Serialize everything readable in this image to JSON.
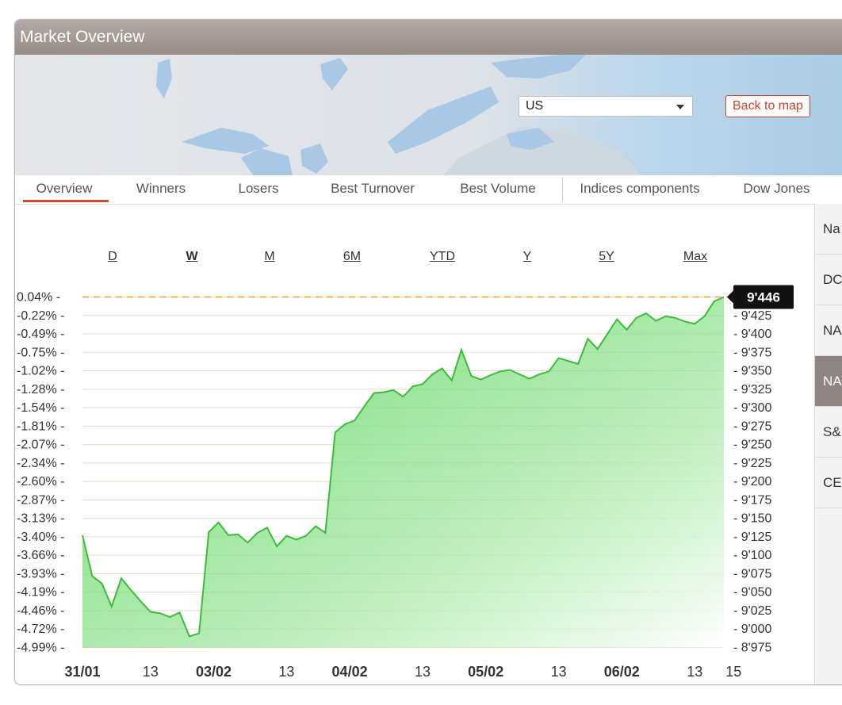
{
  "window": {
    "title": "Market Overview"
  },
  "map": {
    "region_select": {
      "value": "US"
    },
    "back_button": {
      "label": "Back to map"
    }
  },
  "tabs": [
    {
      "label": "Overview",
      "active": true
    },
    {
      "label": "Winners"
    },
    {
      "label": "Losers"
    },
    {
      "label": "Best Turnover"
    },
    {
      "label": "Best Volume"
    },
    {
      "label": "Indices components"
    },
    {
      "label": "Dow Jones"
    }
  ],
  "side_list": [
    {
      "label": "Na"
    },
    {
      "label": "DC"
    },
    {
      "label": "NA"
    },
    {
      "label": "NA",
      "active": true
    },
    {
      "label": "S&"
    },
    {
      "label": "CE"
    }
  ],
  "periods": [
    {
      "label": "D"
    },
    {
      "label": "W",
      "active": true
    },
    {
      "label": "M"
    },
    {
      "label": "6M"
    },
    {
      "label": "YTD"
    },
    {
      "label": "Y"
    },
    {
      "label": "5Y"
    },
    {
      "label": "Max"
    }
  ],
  "colors": {
    "accent": "#d24a2a",
    "line": "#3bbd3b",
    "fill": "#55cc55",
    "ref_line": "#f5a030"
  },
  "chart_data": {
    "type": "area",
    "ylim": [
      8975,
      9446
    ],
    "current_value_label": "9'446",
    "y_right_ticks": [
      "9'425",
      "9'400",
      "9'375",
      "9'350",
      "9'325",
      "9'300",
      "9'275",
      "9'250",
      "9'225",
      "9'200",
      "9'175",
      "9'150",
      "9'125",
      "9'100",
      "9'075",
      "9'050",
      "9'025",
      "9'000",
      "8'975"
    ],
    "y_left_ticks": [
      "0.04%",
      "0.22%",
      "0.49%",
      "0.75%",
      "1.02%",
      "1.28%",
      "1.54%",
      "1.81%",
      "2.07%",
      "2.34%",
      "2.60%",
      "2.87%",
      "3.13%",
      "3.40%",
      "3.66%",
      "3.93%",
      "4.19%",
      "4.46%",
      "4.72%",
      "4.99%"
    ],
    "y_left_tick_prefixes": [
      "",
      "-",
      "-",
      "-",
      "-",
      "-",
      "-",
      "-",
      "-",
      "-",
      "-",
      "-",
      "-",
      "-",
      "-",
      "-",
      "-",
      "-",
      "-",
      "-"
    ],
    "x_ticks": [
      {
        "label": "31/01",
        "x": 0,
        "bold": true
      },
      {
        "label": "13",
        "x": 7
      },
      {
        "label": "03/02",
        "x": 13.5,
        "bold": true
      },
      {
        "label": "13",
        "x": 21
      },
      {
        "label": "04/02",
        "x": 27.5,
        "bold": true
      },
      {
        "label": "13",
        "x": 35
      },
      {
        "label": "05/02",
        "x": 41.5,
        "bold": true
      },
      {
        "label": "13",
        "x": 49
      },
      {
        "label": "06/02",
        "x": 55.5,
        "bold": true
      },
      {
        "label": "13",
        "x": 63
      },
      {
        "label": "15",
        "x": 67
      }
    ],
    "series": [
      {
        "values": [
          9126,
          9071,
          9061,
          9030,
          9068,
          9052,
          9037,
          9023,
          9021,
          9016,
          9022,
          8990,
          8994,
          9130,
          9143,
          9126,
          9127,
          9116,
          9129,
          9136,
          9111,
          9125,
          9120,
          9125,
          9138,
          9129,
          9264,
          9275,
          9280,
          9299,
          9317,
          9318,
          9321,
          9312,
          9326,
          9329,
          9342,
          9350,
          9334,
          9375,
          9340,
          9335,
          9341,
          9346,
          9348,
          9342,
          9336,
          9342,
          9346,
          9364,
          9360,
          9356,
          9390,
          9376,
          9396,
          9416,
          9402,
          9418,
          9424,
          9414,
          9420,
          9418,
          9413,
          9410,
          9420,
          9440,
          9446
        ]
      }
    ]
  }
}
